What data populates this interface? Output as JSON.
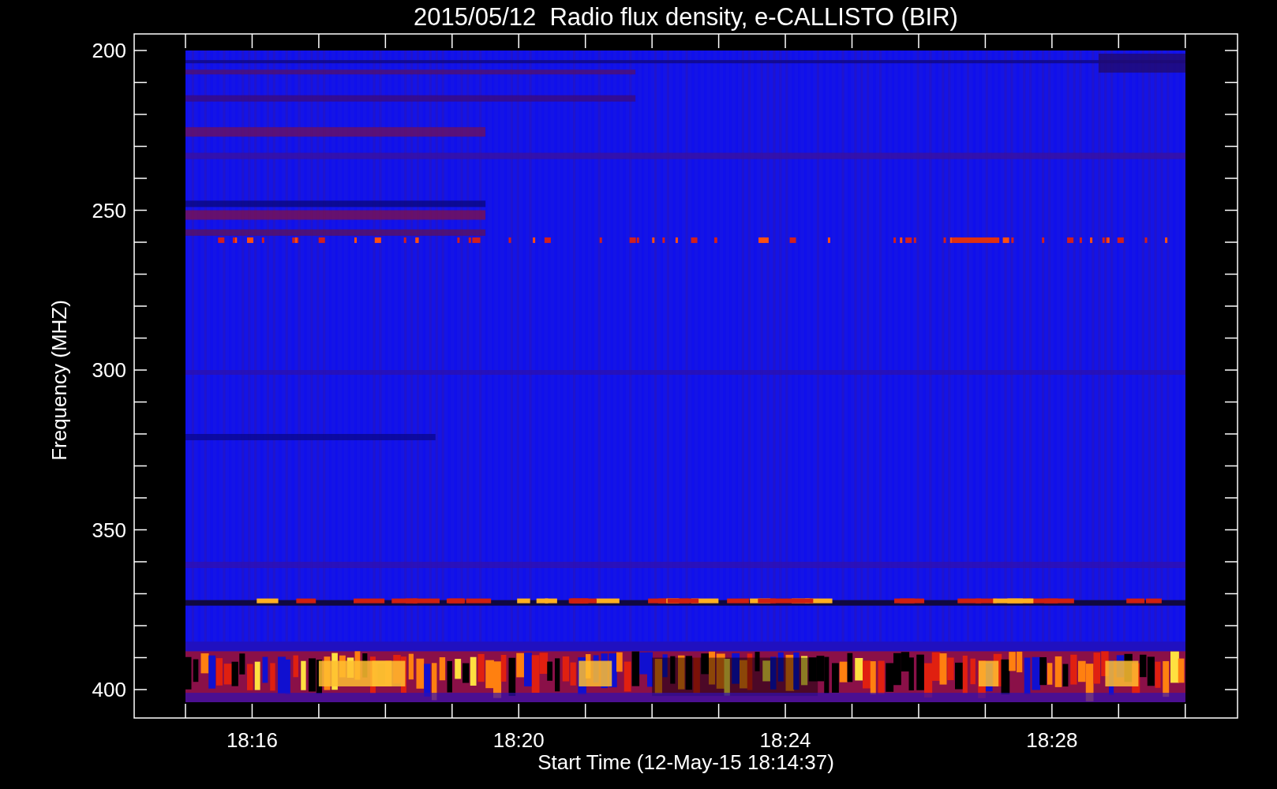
{
  "title": "2015/05/12  Radio flux density, e-CALLISTO (BIR)",
  "y_axis": {
    "label": "Frequency (MHZ)",
    "ticks": [
      "200",
      "250",
      "300",
      "350",
      "400"
    ]
  },
  "x_axis": {
    "label": "Start Time (12-May-15 18:14:37)",
    "ticks": [
      "18:16",
      "18:20",
      "18:24",
      "18:28"
    ]
  }
}
